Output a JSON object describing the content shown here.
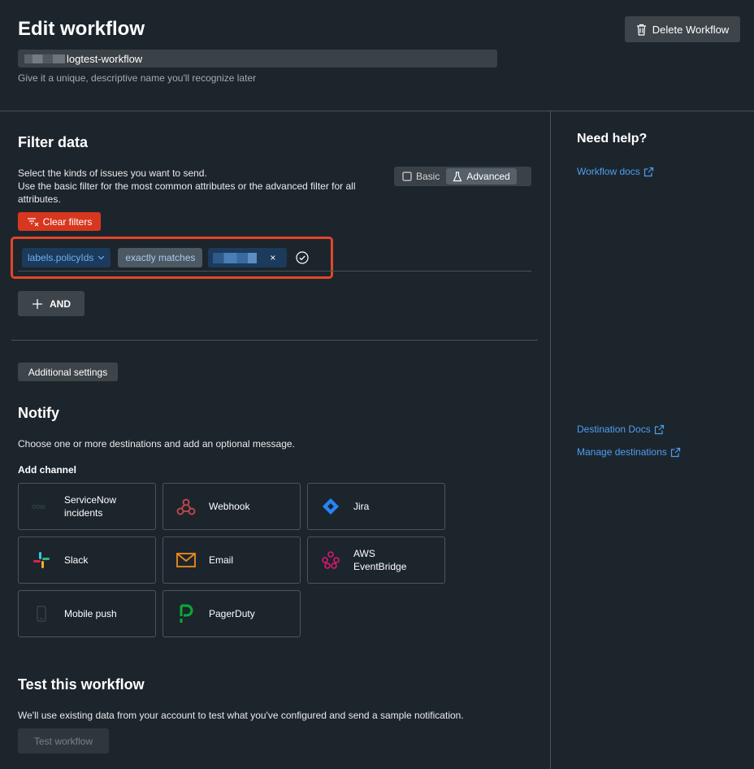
{
  "header": {
    "title": "Edit workflow",
    "delete_label": "Delete Workflow",
    "name_value": "logtest-workflow",
    "name_hint": "Give it a unique, descriptive name you'll recognize later"
  },
  "filter": {
    "title": "Filter data",
    "desc_line1": "Select the kinds of issues you want to send.",
    "desc_line2": "Use the basic filter for the most common attributes or the advanced filter for all",
    "desc_line3": "attributes.",
    "toggle_basic": "Basic",
    "toggle_advanced": "Advanced",
    "clear_label": "Clear filters",
    "attribute": "labels.policyIds",
    "operator": "exactly matches",
    "remove_glyph": "×",
    "and_label": "AND"
  },
  "additional_settings_label": "Additional settings",
  "notify": {
    "title": "Notify",
    "desc": "Choose one or more destinations and add an optional message.",
    "add_channel_label": "Add channel",
    "channels": [
      {
        "label_1": "ServiceNow",
        "label_2": "incidents",
        "icon": "servicenow-icon"
      },
      {
        "label_1": "Webhook",
        "label_2": "",
        "icon": "webhook-icon"
      },
      {
        "label_1": "Jira",
        "label_2": "",
        "icon": "jira-icon"
      },
      {
        "label_1": "Slack",
        "label_2": "",
        "icon": "slack-icon"
      },
      {
        "label_1": "Email",
        "label_2": "",
        "icon": "email-icon"
      },
      {
        "label_1": "AWS",
        "label_2": "EventBridge",
        "icon": "aws-eventbridge-icon"
      },
      {
        "label_1": "Mobile push",
        "label_2": "",
        "icon": "mobile-icon"
      },
      {
        "label_1": "PagerDuty",
        "label_2": "",
        "icon": "pagerduty-icon"
      }
    ]
  },
  "test": {
    "title": "Test this workflow",
    "desc": "We'll use existing data from your account to test what you've configured and send a sample notification.",
    "button_label": "Test workflow"
  },
  "help": {
    "title": "Need help?",
    "workflow_docs": "Workflow docs",
    "destination_docs": "Destination Docs",
    "manage_destinations": "Manage destinations"
  },
  "colors": {
    "background": "#1d252c",
    "link": "#4d9ef2",
    "danger": "#d8371f",
    "highlight": "#e0472b"
  }
}
